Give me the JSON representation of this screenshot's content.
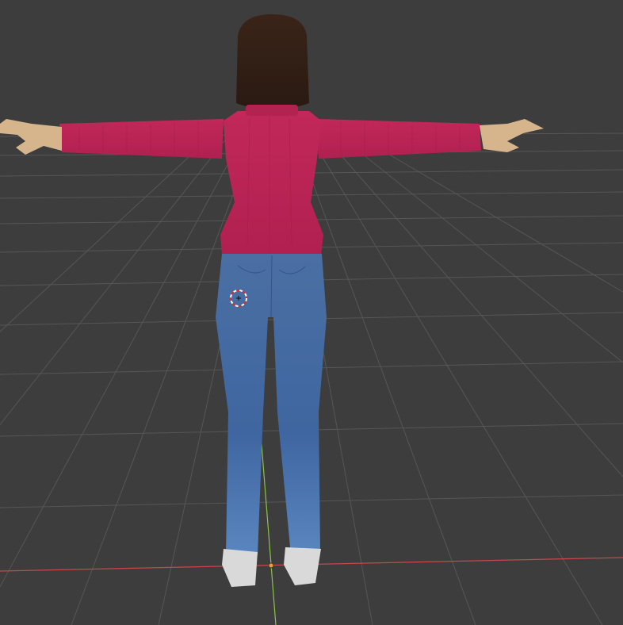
{
  "viewport": {
    "background_color": "#3d3d3d",
    "grid_color": "#555555",
    "x_axis_color": "#c8474a",
    "y_axis_color": "#8bc34a"
  },
  "model": {
    "hair_color": "#3a2419",
    "sweater_color": "#c2285a",
    "jeans_color": "#4a72a8",
    "skin_color": "#d6b58c",
    "shoe_color": "#d9d9d9"
  },
  "icons": {
    "cursor": "3d-cursor-icon",
    "origin": "origin-point-icon"
  }
}
